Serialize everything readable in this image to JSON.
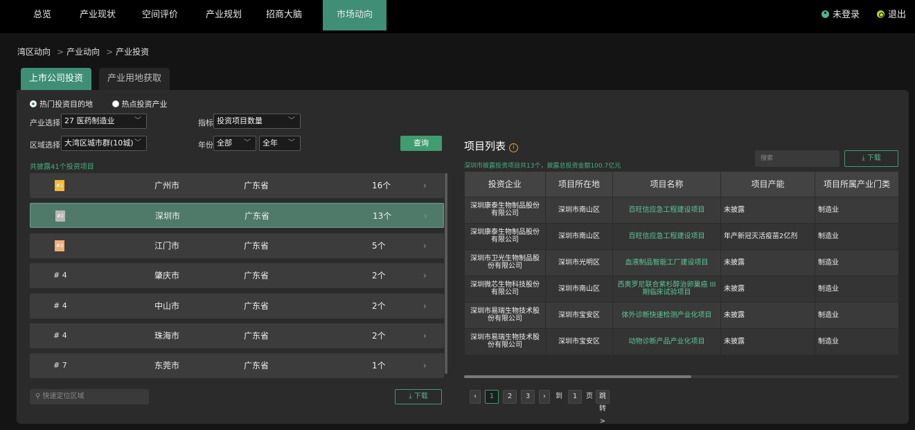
{
  "nav": {
    "items": [
      "总览",
      "产业现状",
      "空间评价",
      "产业规划",
      "招商大脑",
      "市场动向"
    ],
    "active_index": 5,
    "login_label": "未登录",
    "logout_label": "退出"
  },
  "breadcrumb": [
    "湾区动向",
    "产业动向",
    "产业投资"
  ],
  "breadcrumb_sep": ">",
  "tabs": [
    "上市公司投资",
    "产业用地获取"
  ],
  "radios": [
    "热门投资目的地",
    "热点投资产业"
  ],
  "filters": {
    "industry_label": "产业选择",
    "industry_value": "27 医药制造业",
    "metric_label": "指标",
    "metric_value": "投资项目数量",
    "region_label": "区域选择",
    "region_value": "大湾区城市群(10城)",
    "year_label": "年份",
    "year_value": "全部",
    "period_value": "全年",
    "query_label": "查询"
  },
  "total_note": "共披露41个投资项目",
  "ranking": [
    {
      "rank": "#1",
      "city": "广州市",
      "province": "广东省",
      "count": "16个"
    },
    {
      "rank": "#2",
      "city": "深圳市",
      "province": "广东省",
      "count": "13个"
    },
    {
      "rank": "#3",
      "city": "江门市",
      "province": "广东省",
      "count": "5个"
    },
    {
      "rank": "# 4",
      "city": "肇庆市",
      "province": "广东省",
      "count": "2个"
    },
    {
      "rank": "# 4",
      "city": "中山市",
      "province": "广东省",
      "count": "2个"
    },
    {
      "rank": "# 4",
      "city": "珠海市",
      "province": "广东省",
      "count": "2个"
    },
    {
      "rank": "# 7",
      "city": "东莞市",
      "province": "广东省",
      "count": "1个"
    }
  ],
  "left_search_placeholder": "快速定位区域",
  "download_label": "⤓ 下载",
  "project": {
    "title": "项目列表",
    "note": "深圳市披露投资项目共13个，披露总投资金额100.7亿元",
    "search_placeholder": "搜索",
    "columns": [
      "投资企业",
      "项目所在地",
      "项目名称",
      "项目产能",
      "项目所属产业门类"
    ],
    "rows": [
      [
        "深圳康泰生物制品股份有限公司",
        "深圳市南山区",
        "百旺信应急工程建设项目",
        "未披露",
        "制造业"
      ],
      [
        "深圳康泰生物制品股份有限公司",
        "深圳市南山区",
        "百旺信应急工程建设项目",
        "年产新冠灭活疫苗2亿剂",
        "制造业"
      ],
      [
        "深圳市卫光生物制品股份有限公司",
        "深圳市光明区",
        "血液制品智能工厂建设项目",
        "未披露",
        "制造业"
      ],
      [
        "深圳微芯生物科技股份有限公司",
        "深圳市南山区",
        "西奥罗尼联合紫杉醇治卵巢癌 III 期临床试验项目",
        "未披露",
        "制造业"
      ],
      [
        "深圳市易瑞生物技术股份有限公司",
        "深圳市宝安区",
        "体外诊断快速检测产业化项目",
        "未披露",
        "制造业"
      ],
      [
        "深圳市易瑞生物技术股份有限公司",
        "深圳市宝安区",
        "动物诊断产品产业化项目",
        "未披露",
        "制造业"
      ]
    ]
  },
  "pager": {
    "prev": "‹",
    "pages": [
      "1",
      "2",
      "3"
    ],
    "current": "1",
    "next": "›",
    "goto_label": "到",
    "goto_value": "1",
    "page_label": "页",
    "jump_label": "跳转 >"
  }
}
